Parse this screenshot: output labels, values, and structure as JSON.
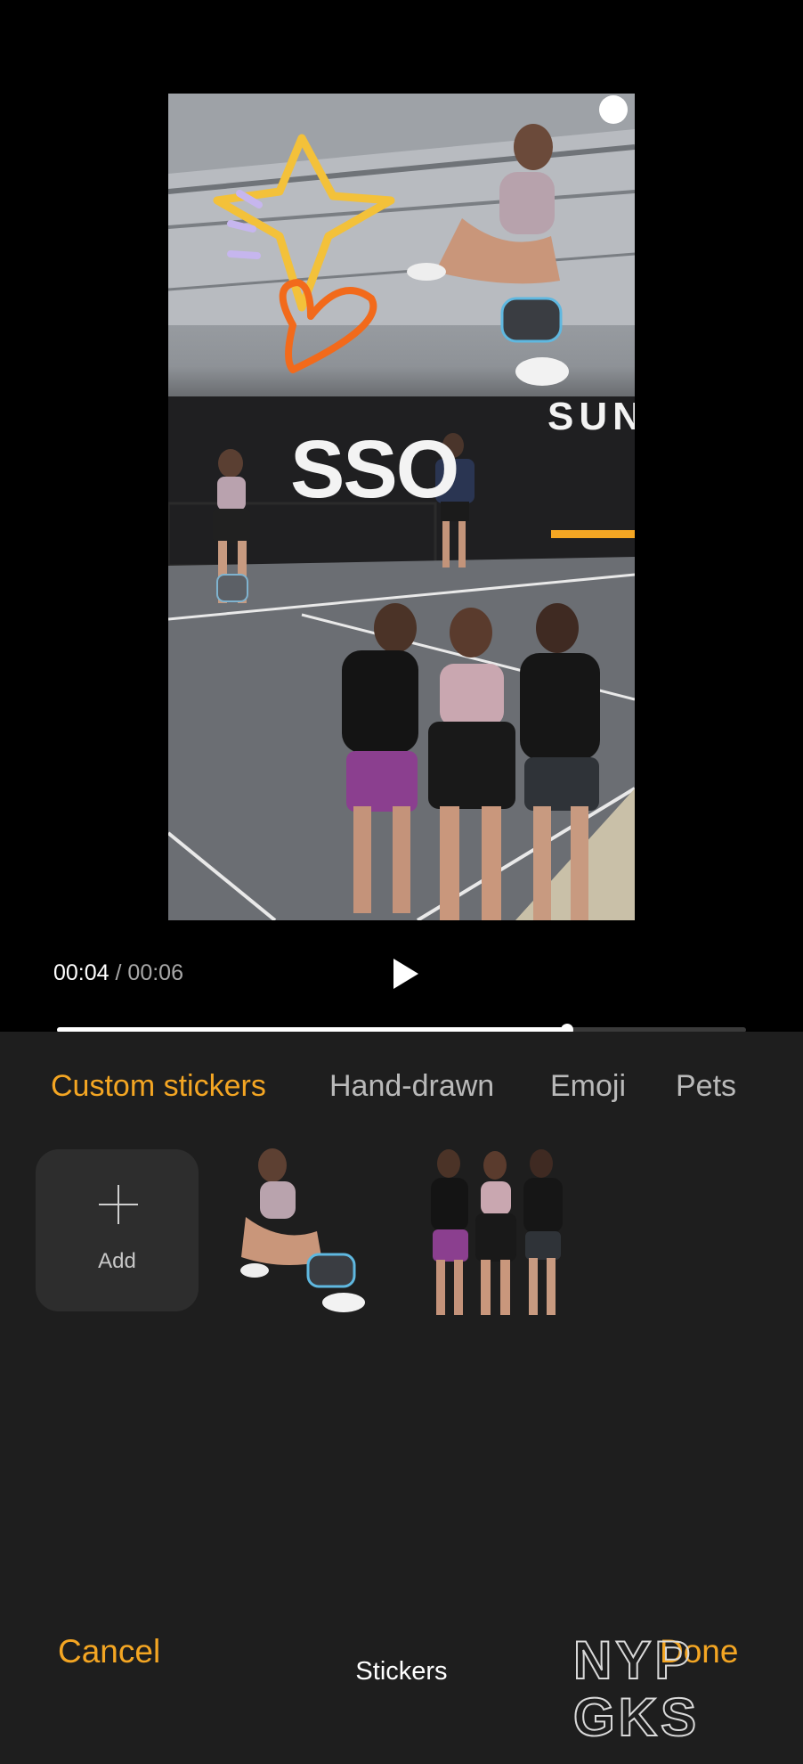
{
  "player": {
    "current_time": "00:04",
    "separator": "/",
    "total_time": "00:06",
    "progress": 0.74
  },
  "preview": {
    "sign_text_1": "SSO",
    "sign_text_2": "SUN"
  },
  "tabs": [
    {
      "label": "Custom stickers",
      "active": true
    },
    {
      "label": "Hand-drawn",
      "active": false
    },
    {
      "label": "Emoji",
      "active": false
    },
    {
      "label": "Pets",
      "active": false
    }
  ],
  "stickers": {
    "add_label": "Add"
  },
  "footer": {
    "cancel_label": "Cancel",
    "title": "Stickers",
    "done_label": "Done"
  },
  "watermark": {
    "text_line1": "NYP",
    "text_line2": "GKS"
  },
  "colors": {
    "accent": "#f4a623",
    "sheet_bg": "#1e1e1e"
  }
}
